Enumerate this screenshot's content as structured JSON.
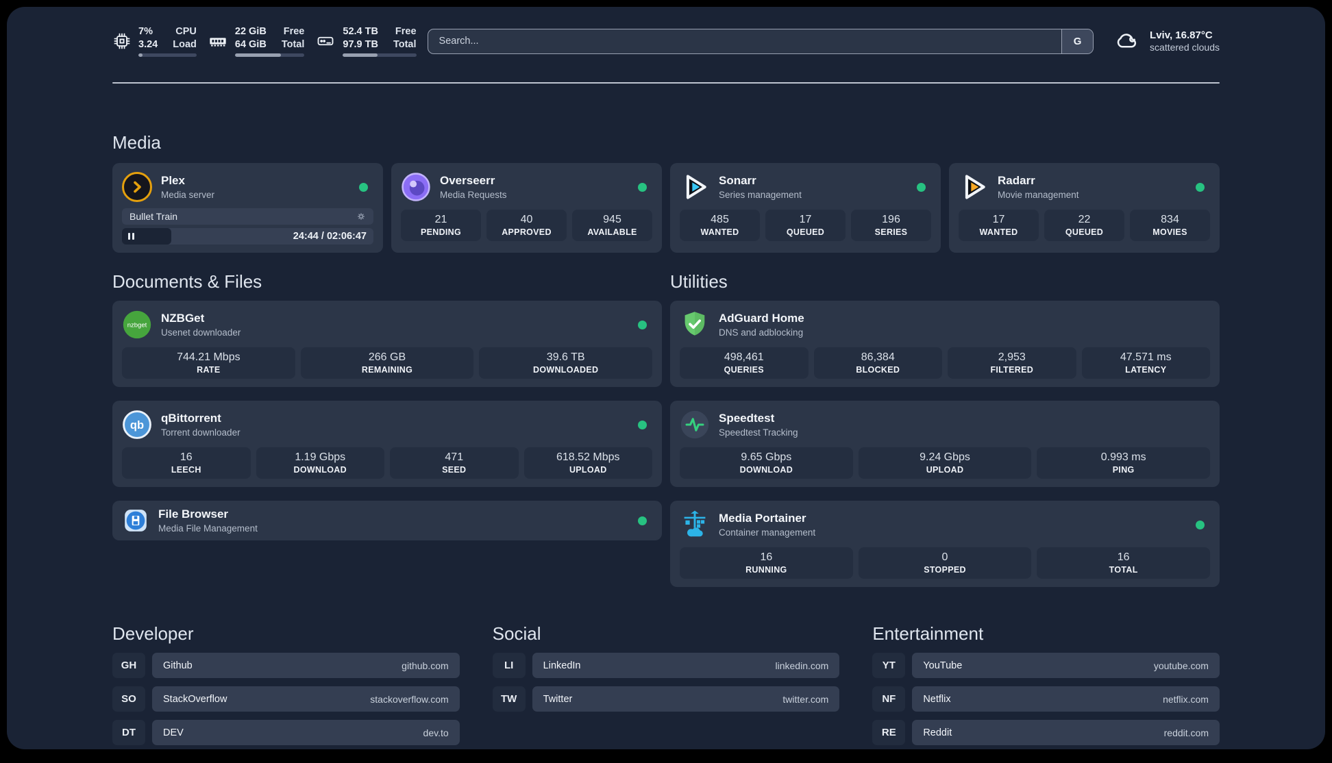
{
  "colors": {
    "background": "#1a2335",
    "card": "#2c3648",
    "stat_box": "#242e40",
    "status_online": "#27c281",
    "plex_accent": "#e5a00d",
    "sonarr_accent": "#38c6f4",
    "radarr_accent": "#f7a825",
    "nzbget_accent": "#46a53d",
    "qbittorrent_accent": "#4c96d8",
    "adguard_accent": "#5dbb63",
    "speedtest_accent": "#35d07e",
    "portainer_accent": "#2cb4e8"
  },
  "header": {
    "system": [
      {
        "icon": "cpu-icon",
        "values": [
          "7%",
          "3.24"
        ],
        "labels": [
          "CPU",
          "Load"
        ],
        "progress_pct": 7
      },
      {
        "icon": "ram-icon",
        "values": [
          "22 GiB",
          "64 GiB"
        ],
        "labels": [
          "Free",
          "Total"
        ],
        "progress_pct": 66
      },
      {
        "icon": "disk-icon",
        "values": [
          "52.4 TB",
          "97.9 TB"
        ],
        "labels": [
          "Free",
          "Total"
        ],
        "progress_pct": 47
      }
    ],
    "search": {
      "placeholder": "Search...",
      "button": "G"
    },
    "weather": {
      "line1": "Lviv, 16.87°C",
      "line2": "scattered clouds"
    }
  },
  "sections": {
    "media": {
      "title": "Media",
      "apps": [
        {
          "name": "Plex",
          "desc": "Media server",
          "online": true,
          "player": {
            "title": "Bullet Train",
            "time": "24:44 / 02:06:47",
            "progress_pct": 19.5
          }
        },
        {
          "name": "Overseerr",
          "desc": "Media Requests",
          "online": true,
          "stats": [
            {
              "value": "21",
              "label": "PENDING"
            },
            {
              "value": "40",
              "label": "APPROVED"
            },
            {
              "value": "945",
              "label": "AVAILABLE"
            }
          ]
        },
        {
          "name": "Sonarr",
          "desc": "Series management",
          "online": true,
          "stats": [
            {
              "value": "485",
              "label": "WANTED"
            },
            {
              "value": "17",
              "label": "QUEUED"
            },
            {
              "value": "196",
              "label": "SERIES"
            }
          ]
        },
        {
          "name": "Radarr",
          "desc": "Movie management",
          "online": true,
          "stats": [
            {
              "value": "17",
              "label": "WANTED"
            },
            {
              "value": "22",
              "label": "QUEUED"
            },
            {
              "value": "834",
              "label": "MOVIES"
            }
          ]
        }
      ]
    },
    "documents": {
      "title": "Documents & Files",
      "apps": [
        {
          "name": "NZBGet",
          "desc": "Usenet downloader",
          "icon_text": "nzbget",
          "online": true,
          "stats": [
            {
              "value": "744.21 Mbps",
              "label": "RATE"
            },
            {
              "value": "266 GB",
              "label": "REMAINING"
            },
            {
              "value": "39.6 TB",
              "label": "DOWNLOADED"
            }
          ]
        },
        {
          "name": "qBittorrent",
          "desc": "Torrent downloader",
          "icon_text": "qb",
          "online": true,
          "stats": [
            {
              "value": "16",
              "label": "LEECH"
            },
            {
              "value": "1.19 Gbps",
              "label": "DOWNLOAD"
            },
            {
              "value": "471",
              "label": "SEED"
            },
            {
              "value": "618.52 Mbps",
              "label": "UPLOAD"
            }
          ]
        },
        {
          "name": "File Browser",
          "desc": "Media File Management",
          "online": true
        }
      ]
    },
    "utilities": {
      "title": "Utilities",
      "apps": [
        {
          "name": "AdGuard Home",
          "desc": "DNS and adblocking",
          "stats": [
            {
              "value": "498,461",
              "label": "QUERIES"
            },
            {
              "value": "86,384",
              "label": "BLOCKED"
            },
            {
              "value": "2,953",
              "label": "FILTERED"
            },
            {
              "value": "47.571 ms",
              "label": "LATENCY"
            }
          ]
        },
        {
          "name": "Speedtest",
          "desc": "Speedtest Tracking",
          "stats": [
            {
              "value": "9.65 Gbps",
              "label": "DOWNLOAD"
            },
            {
              "value": "9.24 Gbps",
              "label": "UPLOAD"
            },
            {
              "value": "0.993 ms",
              "label": "PING"
            }
          ]
        },
        {
          "name": "Media Portainer",
          "desc": "Container management",
          "online": true,
          "stats": [
            {
              "value": "16",
              "label": "RUNNING"
            },
            {
              "value": "0",
              "label": "STOPPED"
            },
            {
              "value": "16",
              "label": "TOTAL"
            }
          ]
        }
      ]
    },
    "links": {
      "developer": {
        "title": "Developer",
        "items": [
          {
            "tag": "GH",
            "name": "Github",
            "url": "github.com"
          },
          {
            "tag": "SO",
            "name": "StackOverflow",
            "url": "stackoverflow.com"
          },
          {
            "tag": "DT",
            "name": "DEV",
            "url": "dev.to"
          }
        ]
      },
      "social": {
        "title": "Social",
        "items": [
          {
            "tag": "LI",
            "name": "LinkedIn",
            "url": "linkedin.com"
          },
          {
            "tag": "TW",
            "name": "Twitter",
            "url": "twitter.com"
          }
        ]
      },
      "entertainment": {
        "title": "Entertainment",
        "items": [
          {
            "tag": "YT",
            "name": "YouTube",
            "url": "youtube.com"
          },
          {
            "tag": "NF",
            "name": "Netflix",
            "url": "netflix.com"
          },
          {
            "tag": "RE",
            "name": "Reddit",
            "url": "reddit.com"
          }
        ]
      }
    }
  }
}
